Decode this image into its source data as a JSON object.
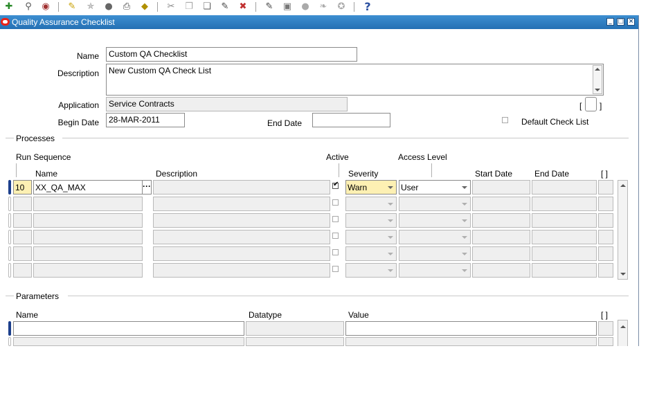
{
  "toolbar": {
    "icons": [
      "new-record-icon",
      "find-icon",
      "navigator-icon",
      "save-icon",
      "next-step-icon",
      "switch-responsibility-icon",
      "print-icon",
      "close-form-icon",
      "cut-icon",
      "copy-icon",
      "paste-icon",
      "clear-record-icon",
      "delete-record-icon",
      "edit-field-icon",
      "zoom-icon",
      "translations-icon",
      "attachments-icon",
      "folder-tools-icon",
      "help-icon"
    ],
    "help_glyph": "?"
  },
  "window": {
    "title": "Quality Assurance Checklist"
  },
  "header": {
    "name_label": "Name",
    "name_value": "Custom QA Checklist",
    "description_label": "Description",
    "description_value": "New Custom QA Check List",
    "application_label": "Application",
    "application_value": "Service Contracts",
    "begin_date_label": "Begin Date",
    "begin_date_value": "28-MAR-2011",
    "end_date_label": "End Date",
    "end_date_value": "",
    "dff_left": "[",
    "dff_right": "]",
    "default_check_list_label": "Default Check List"
  },
  "processes": {
    "section_title": "Processes",
    "col_run_sequence": "Run Sequence",
    "col_name": "Name",
    "col_description": "Description",
    "col_active": "Active",
    "col_access_level": "Access Level",
    "col_severity": "Severity",
    "col_start_date": "Start Date",
    "col_end_date": "End Date",
    "col_dff": "[ ]",
    "rows": [
      {
        "seq": "10",
        "name": "XX_QA_MAX",
        "description": "",
        "active": true,
        "severity": "Warn",
        "access": "User",
        "start": "",
        "end": ""
      },
      {
        "seq": "",
        "name": "",
        "description": "",
        "active": false,
        "severity": "",
        "access": "",
        "start": "",
        "end": ""
      },
      {
        "seq": "",
        "name": "",
        "description": "",
        "active": false,
        "severity": "",
        "access": "",
        "start": "",
        "end": ""
      },
      {
        "seq": "",
        "name": "",
        "description": "",
        "active": false,
        "severity": "",
        "access": "",
        "start": "",
        "end": ""
      },
      {
        "seq": "",
        "name": "",
        "description": "",
        "active": false,
        "severity": "",
        "access": "",
        "start": "",
        "end": ""
      },
      {
        "seq": "",
        "name": "",
        "description": "",
        "active": false,
        "severity": "",
        "access": "",
        "start": "",
        "end": ""
      }
    ]
  },
  "parameters": {
    "section_title": "Parameters",
    "col_name": "Name",
    "col_datatype": "Datatype",
    "col_value": "Value",
    "col_dff": "[ ]"
  },
  "colors": {
    "titlebar": "#2a78bd",
    "current_row_marker": "#1c3f8c",
    "warn_cell": "#fdf0b3",
    "oracle_red": "#e8231a"
  }
}
